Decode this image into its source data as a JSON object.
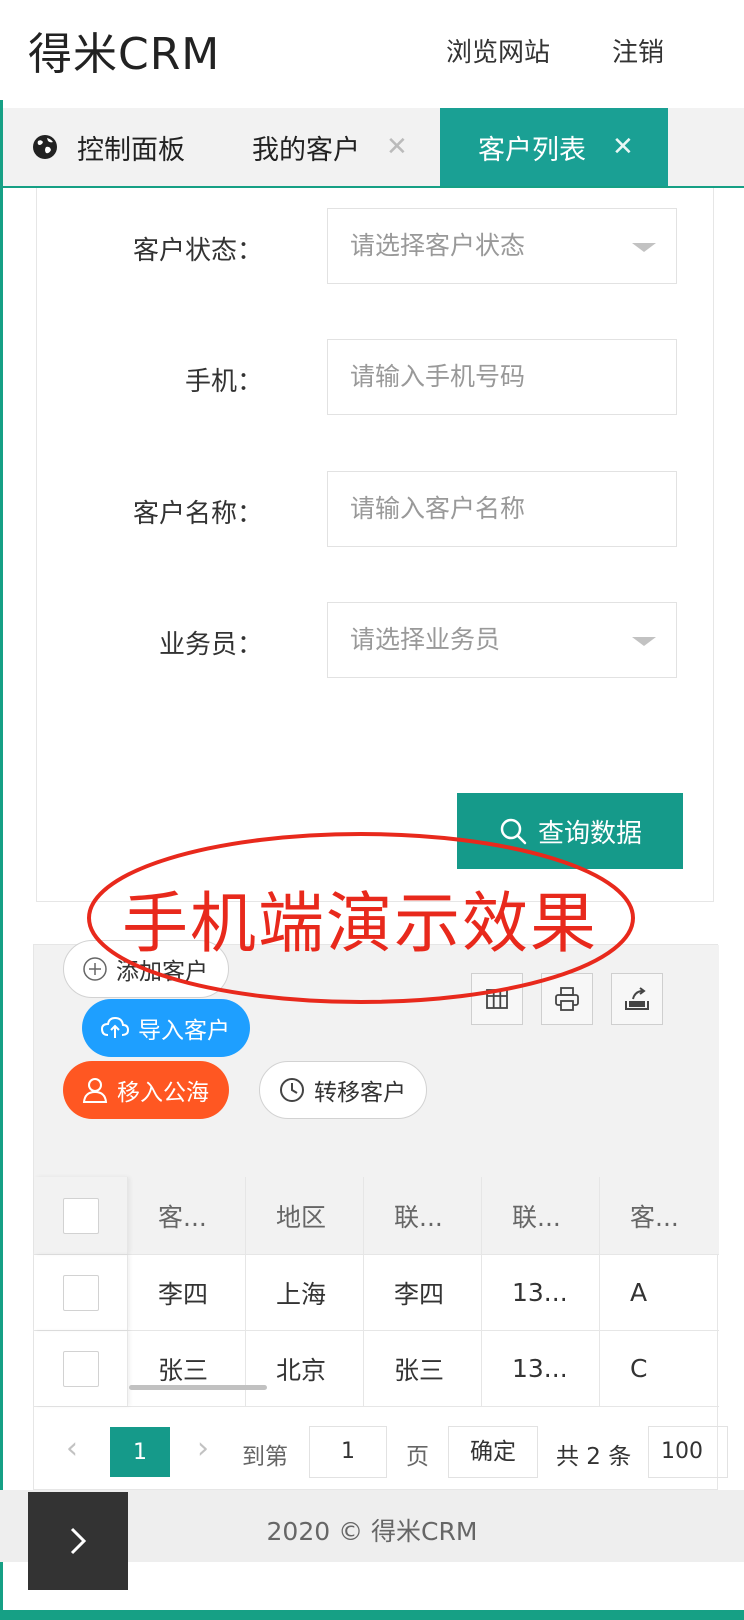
{
  "header": {
    "logo": "得米CRM",
    "browse_site": "浏览网站",
    "logout": "注销"
  },
  "tabs": [
    {
      "label": "控制面板",
      "icon": "globe-icon",
      "closable": false
    },
    {
      "label": "我的客户",
      "closable": true
    },
    {
      "label": "客户列表",
      "closable": true,
      "active": true
    }
  ],
  "tab_close_glyph": "✕",
  "form": {
    "status_label": "客户状态：",
    "status_placeholder": "请选择客户状态",
    "phone_label": "手机：",
    "phone_placeholder": "请输入手机号码",
    "name_label": "客户名称：",
    "name_placeholder": "请输入客户名称",
    "salesman_label": "业务员：",
    "salesman_placeholder": "请选择业务员",
    "query_button": "查询数据"
  },
  "overlay_text": "手机端演示效果",
  "toolbar": {
    "add_customer": "添加客户",
    "import_customer": "导入客户",
    "move_to_pool": "移入公海",
    "transfer_customer": "转移客户",
    "icons": [
      "columns-icon",
      "print-icon",
      "export-icon"
    ]
  },
  "table": {
    "columns": [
      "客...",
      "地区",
      "联...",
      "联...",
      "客..."
    ],
    "rows": [
      [
        "李四",
        "上海",
        "李四",
        "13...",
        "A"
      ],
      [
        "张三",
        "北京",
        "张三",
        "13...",
        "C"
      ]
    ]
  },
  "pagination": {
    "prev": "‹",
    "current_page": "1",
    "next": "›",
    "goto_label": "到第",
    "goto_value": "1",
    "page_unit": "页",
    "confirm": "确定",
    "total": "共 2 条",
    "page_size": "100"
  },
  "footer": {
    "text": "2020 ©    得米CRM"
  },
  "colors": {
    "primary": "#159a8a",
    "blue": "#1e9fff",
    "orange": "#ff5722",
    "overlay_red": "#e8291c"
  }
}
